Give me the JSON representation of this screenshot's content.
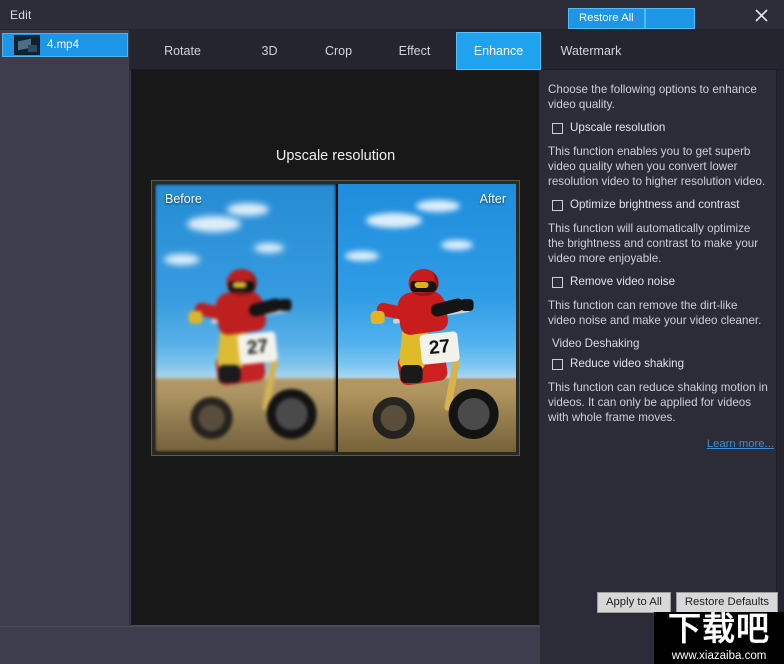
{
  "window": {
    "title": "Edit",
    "close_icon": "close-icon"
  },
  "sidebar": {
    "file_tab": {
      "name": "4.mp4",
      "thumbnail_icon": "video-thumbnail-icon"
    }
  },
  "tabs": [
    {
      "label": "Rotate",
      "active": false
    },
    {
      "label": "3D",
      "active": false
    },
    {
      "label": "Crop",
      "active": false
    },
    {
      "label": "Effect",
      "active": false
    },
    {
      "label": "Enhance",
      "active": true
    },
    {
      "label": "Watermark",
      "active": false
    }
  ],
  "preview": {
    "title": "Upscale resolution",
    "before_label": "Before",
    "after_label": "After",
    "plate_number": "27"
  },
  "options_panel": {
    "intro": "Choose the following options to enhance video quality.",
    "items": [
      {
        "checkbox_label": "Upscale resolution",
        "checked": false,
        "description": "This function enables you to get superb video quality when you convert lower resolution video to higher resolution video."
      },
      {
        "checkbox_label": "Optimize brightness and contrast",
        "checked": false,
        "description": "This function will automatically optimize the brightness and contrast to make your video more enjoyable."
      },
      {
        "checkbox_label": "Remove video noise",
        "checked": false,
        "description": "This function can remove the dirt-like video noise and make your video cleaner."
      }
    ],
    "section_label": "Video Deshaking",
    "deshake": {
      "checkbox_label": "Reduce video shaking",
      "checked": false,
      "description": "This function can reduce shaking motion in videos. It can only be applied for videos with whole frame moves."
    },
    "learn_more": "Learn more..."
  },
  "panel_buttons": {
    "apply_to_all": "Apply to All",
    "restore_defaults": "Restore Defaults"
  },
  "footer": {
    "restore_all": "Restore All",
    "secondary": ""
  },
  "watermark": {
    "brand": "下载吧",
    "url": "www.xiazaiba.com"
  },
  "colors": {
    "accent_blue": "#1e96e8",
    "panel_bg": "#2c2b38",
    "window_bg": "#3e3d4e",
    "preview_bg": "#181818",
    "link_blue": "#3c8fd6"
  }
}
